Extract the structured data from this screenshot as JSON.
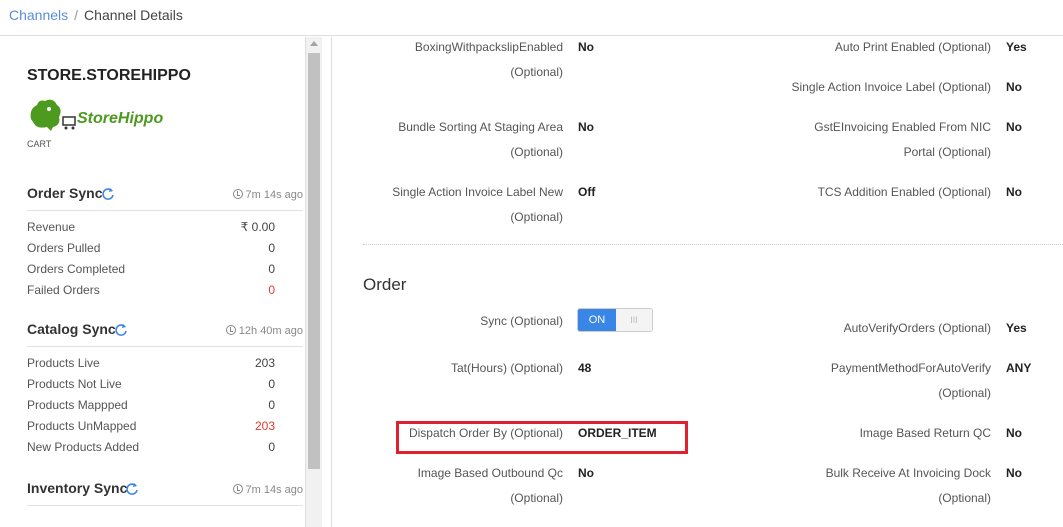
{
  "breadcrumb": {
    "root": "Channels",
    "separator": "/",
    "current": "Channel Details"
  },
  "store": {
    "name": "STORE.STOREHIPPO",
    "logo_text": "StoreHippo",
    "cart_label": "CART"
  },
  "order_sync": {
    "title": "Order Sync",
    "ago": "7m 14s ago",
    "rows": [
      {
        "label": "Revenue",
        "value": "₹ 0.00"
      },
      {
        "label": "Orders Pulled",
        "value": "0"
      },
      {
        "label": "Orders Completed",
        "value": "0"
      },
      {
        "label": "Failed Orders",
        "value": "0"
      }
    ]
  },
  "catalog_sync": {
    "title": "Catalog Sync",
    "ago": "12h 40m ago",
    "rows": [
      {
        "label": "Products Live",
        "value": "203"
      },
      {
        "label": "Products Not Live",
        "value": "0"
      },
      {
        "label": "Products Mappped",
        "value": "0"
      },
      {
        "label": "Products UnMapped",
        "value": "203"
      },
      {
        "label": "New Products Added",
        "value": "0"
      }
    ]
  },
  "inventory_sync": {
    "title": "Inventory Sync",
    "ago": "7m 14s ago"
  },
  "settings": {
    "boxing": {
      "label1": "BoxingWithpackslipEnabled",
      "label2": "(Optional)",
      "value": "No"
    },
    "auto_print": {
      "label": "Auto Print Enabled (Optional)",
      "value": "Yes"
    },
    "single_action_label": {
      "label": "Single Action Invoice Label (Optional)",
      "value": "No"
    },
    "bundle_sorting": {
      "label1": "Bundle Sorting At Staging Area",
      "label2": "(Optional)",
      "value": "No"
    },
    "gst": {
      "label1": "GstEInvoicing Enabled From NIC",
      "label2": "Portal (Optional)",
      "value": "No"
    },
    "single_action_new": {
      "label1": "Single Action Invoice Label New",
      "label2": "(Optional)",
      "value": "Off"
    },
    "tcs": {
      "label": "TCS Addition Enabled (Optional)",
      "value": "No"
    }
  },
  "order": {
    "title": "Order",
    "sync": {
      "label": "Sync (Optional)",
      "on": "ON",
      "off": "III"
    },
    "auto_verify": {
      "label": "AutoVerifyOrders (Optional)",
      "value": "Yes"
    },
    "tat": {
      "label": "Tat(Hours) (Optional)",
      "value": "48"
    },
    "payment_method": {
      "label1": "PaymentMethodForAutoVerify",
      "label2": "(Optional)",
      "value": "ANY"
    },
    "dispatch": {
      "label": "Dispatch Order By (Optional)",
      "value": "ORDER_ITEM"
    },
    "image_return": {
      "label": "Image Based Return QC",
      "value": "No"
    },
    "image_outbound": {
      "label1": "Image Based Outbound Qc",
      "label2": "(Optional)",
      "value": "No"
    },
    "bulk_receive": {
      "label1": "Bulk Receive At Invoicing Dock",
      "label2": "(Optional)",
      "value": "No"
    }
  },
  "colors": {
    "link": "#5b8dd9",
    "red": "#e53935",
    "toggle_on": "#3a86e6",
    "highlight": "#e0202e"
  },
  "icons": [
    "sync-icon",
    "clock-icon",
    "storehippo-logo"
  ]
}
